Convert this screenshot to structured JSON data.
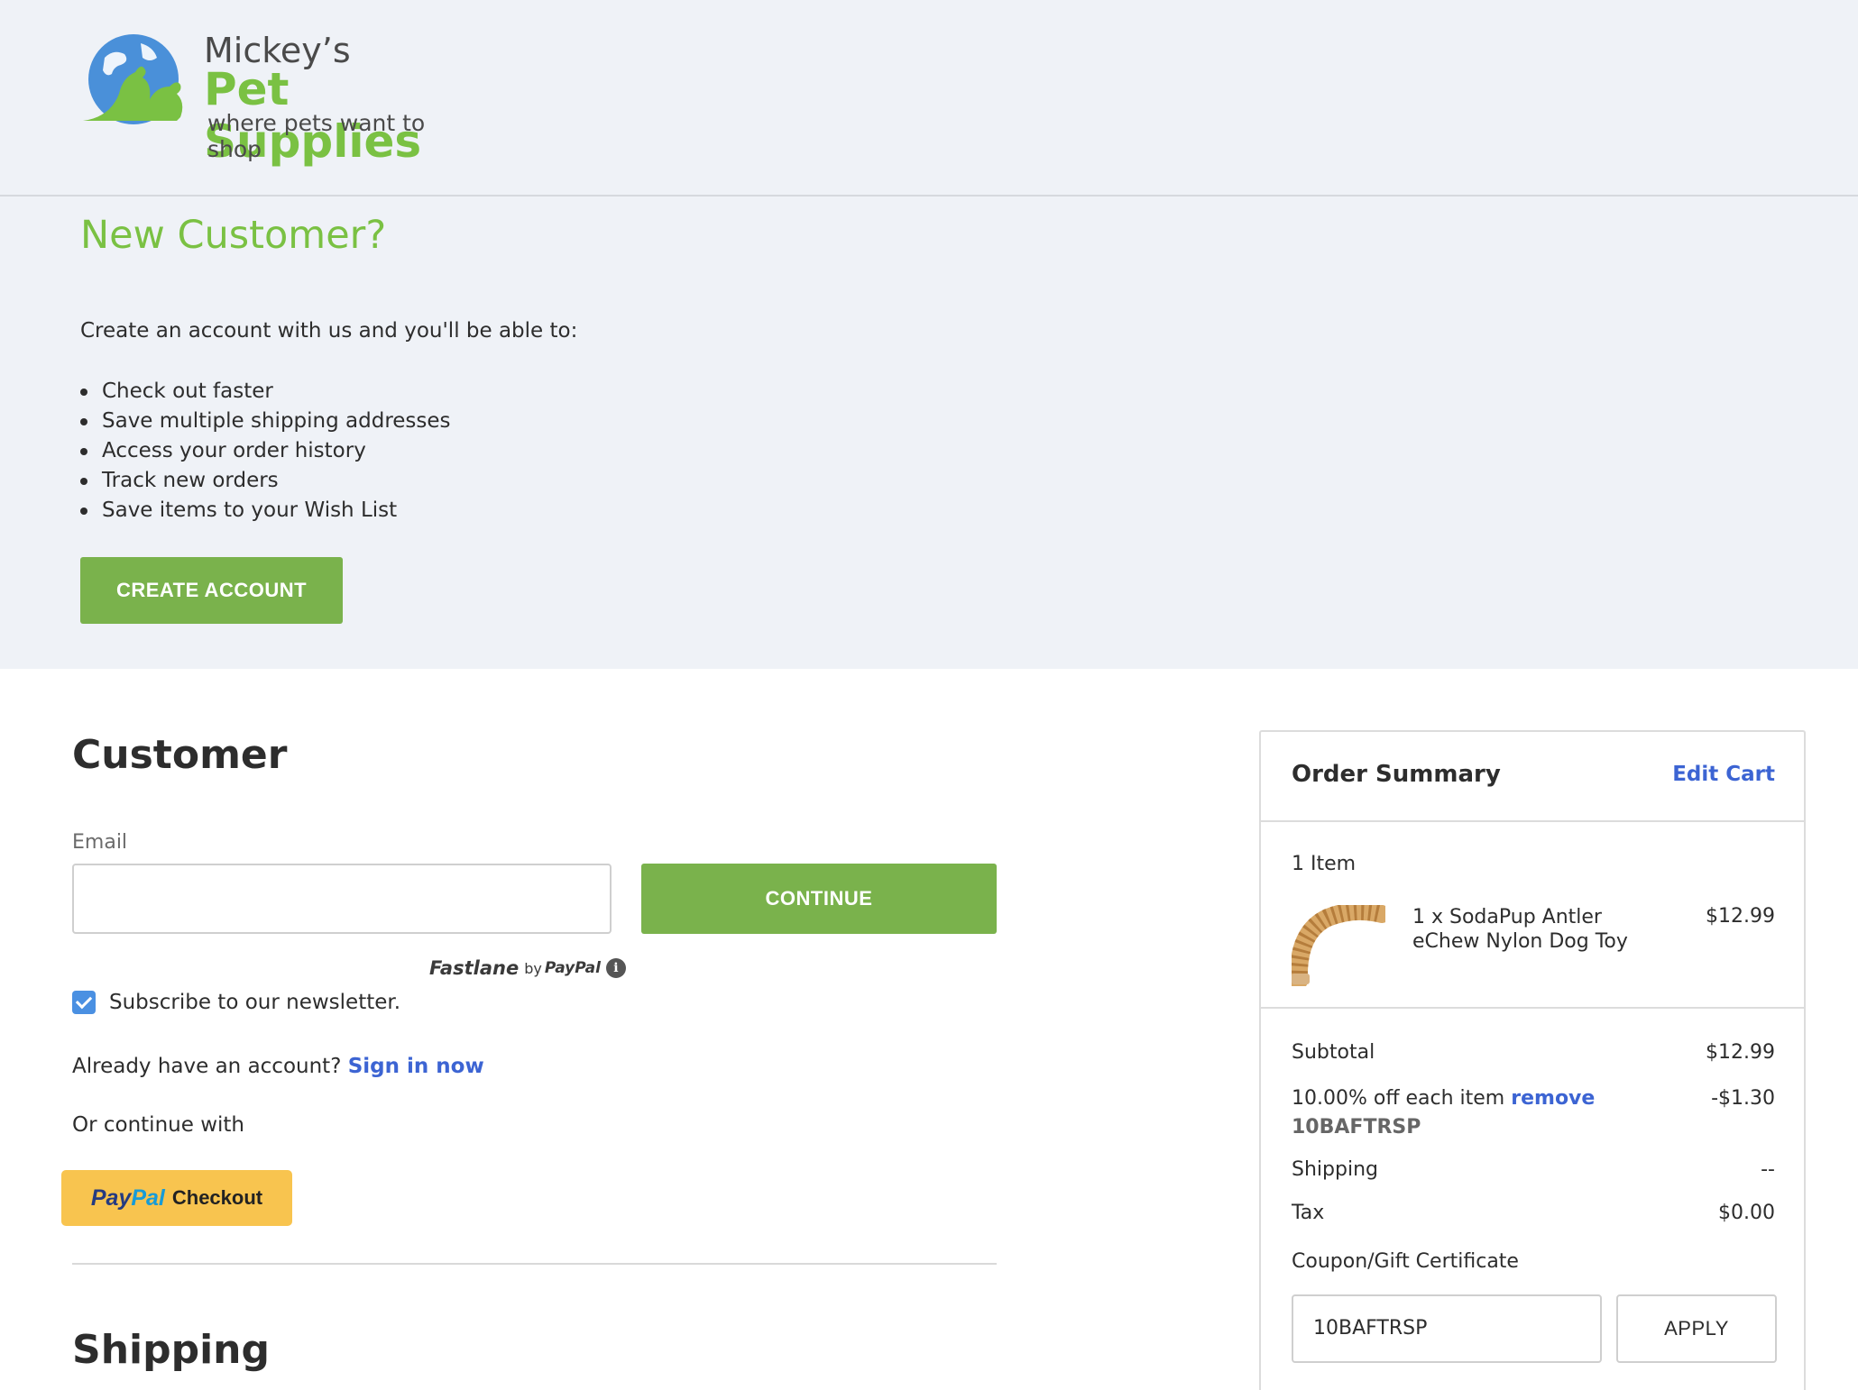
{
  "brand": {
    "line1": "Mickey’s",
    "line2": "Pet Supplies",
    "tagline": "where pets want to shop",
    "green": "#7ac143",
    "blue": "#4a90d9"
  },
  "new_customer": {
    "title": "New Customer?",
    "intro": "Create an account with us and you'll be able to:",
    "benefits": [
      "Check out faster",
      "Save multiple shipping addresses",
      "Access your order history",
      "Track new orders",
      "Save items to your Wish List"
    ],
    "create_button": "CREATE ACCOUNT"
  },
  "customer": {
    "title": "Customer",
    "email_label": "Email",
    "email_value": "",
    "continue_button": "CONTINUE",
    "fastlane": {
      "name": "Fastlane",
      "by": "by",
      "provider": "PayPal",
      "info_icon": "info-icon"
    },
    "newsletter_label": "Subscribe to our newsletter.",
    "newsletter_checked": true,
    "account_prompt": "Already have an account?",
    "signin_link": "Sign in now",
    "continue_with": "Or continue with",
    "paypal": {
      "pay": "Pay",
      "pal": "Pal",
      "label": "Checkout"
    }
  },
  "shipping": {
    "title": "Shipping"
  },
  "order_summary": {
    "title": "Order Summary",
    "edit_cart": "Edit Cart",
    "item_count": "1 Item",
    "items": [
      {
        "name": "1 x SodaPup Antler eChew Nylon Dog Toy",
        "price": "$12.99"
      }
    ],
    "subtotal_label": "Subtotal",
    "subtotal_value": "$12.99",
    "discount_label": "10.00% off each item",
    "discount_remove": "remove",
    "discount_code": "10BAFTRSP",
    "discount_value": "-$1.30",
    "shipping_label": "Shipping",
    "shipping_value": "--",
    "tax_label": "Tax",
    "tax_value": "$0.00",
    "coupon_label": "Coupon/Gift Certificate",
    "coupon_value": "10BAFTRSP",
    "apply_button": "APPLY"
  },
  "colors": {
    "accent_green": "#7ab24c",
    "link_blue": "#3c64d3",
    "paypal_yellow": "#f8c44f",
    "panel_bg": "#eff2f7"
  }
}
